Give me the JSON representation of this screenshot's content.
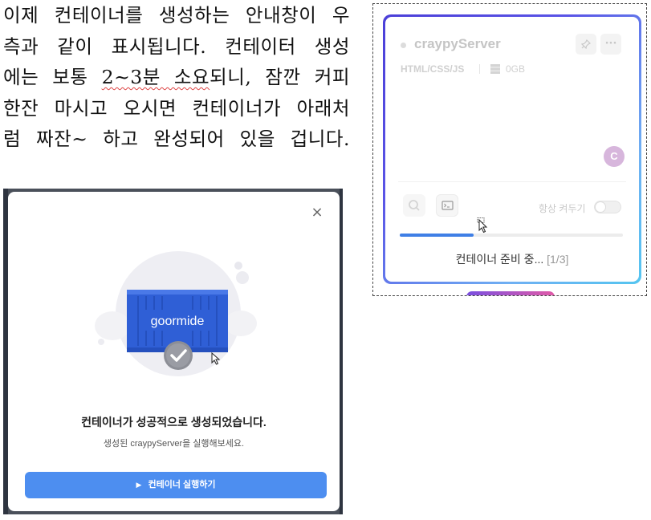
{
  "document": {
    "lines": [
      "이제 컨테이너를 생성하는 안내창이 우",
      "측과 같이 표시됩니다. 컨테이터 생성",
      "에는 보통 2~3분 소요되니, 잠깐 커피",
      "한잔 마시고 오시면 컨테이너가 아래처",
      "럼 짜잔~ 하고 완성되어 있을 겁니다."
    ],
    "line3_before": "에는 보통 ",
    "line3_marked": "2~3분 소요",
    "line3_after": "되니, 잠깐 커피"
  },
  "modal": {
    "close_icon": "×",
    "logo_text": "goormide",
    "title": "컨테이너가 성공적으로 생성되었습니다.",
    "subtitle": "생성된 craypyServer을 실행해보세요.",
    "run_button_icon": "▶",
    "run_button_label": "컨테이너 실행하기"
  },
  "card": {
    "server_name": "craypyServer",
    "stack": "HTML/CSS/JS",
    "storage": "0GB",
    "avatar_letter": "C",
    "always_on_label": "항상 켜두기",
    "always_on": false,
    "progress_fraction": 0.33,
    "progress_text": "컨테이너 준비 중...",
    "progress_step": "[1/3]",
    "pin_icon": "pin-icon",
    "more_icon": "more-icon"
  },
  "colors": {
    "primary_button": "#4d8ef0",
    "progress_fill": "#3f7fe6",
    "card_border_start": "#4b3fd8",
    "card_border_end": "#55c5f0",
    "container_blue": "#2f5fd6"
  }
}
